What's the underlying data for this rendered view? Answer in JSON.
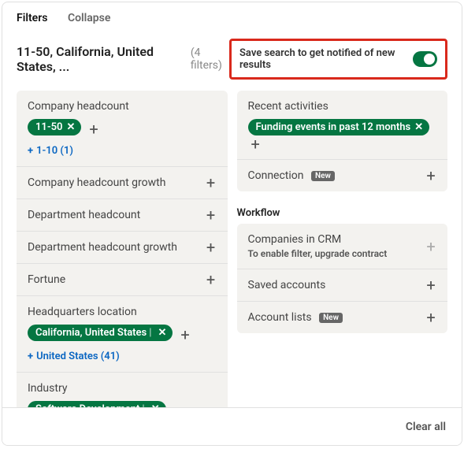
{
  "tabs": {
    "filters": "Filters",
    "collapse": "Collapse"
  },
  "summary": {
    "text": "11-50, California, United States, ...",
    "count": "(4 filters)"
  },
  "save": {
    "label": "Save search to get notified of new results"
  },
  "badges": {
    "new": "New"
  },
  "footer": {
    "clear": "Clear all"
  },
  "left": {
    "headcount": {
      "title": "Company headcount",
      "chip": "11-50",
      "include": "1-10 (1)"
    },
    "growth": {
      "title": "Company headcount growth"
    },
    "dept": {
      "title": "Department headcount"
    },
    "deptGrowth": {
      "title": "Department headcount growth"
    },
    "fortune": {
      "title": "Fortune"
    },
    "hq": {
      "title": "Headquarters location",
      "chip": "California, United States",
      "include": "United States (41)"
    },
    "industry": {
      "title": "Industry",
      "chip": "Software Development"
    }
  },
  "right": {
    "activities": {
      "title": "Recent activities",
      "chip": "Funding events in past 12 months"
    },
    "connection": {
      "title": "Connection"
    },
    "workflowHeader": "Workflow",
    "crm": {
      "title": "Companies in CRM",
      "sub": "To enable filter, upgrade contract"
    },
    "saved": {
      "title": "Saved accounts"
    },
    "lists": {
      "title": "Account lists"
    }
  }
}
